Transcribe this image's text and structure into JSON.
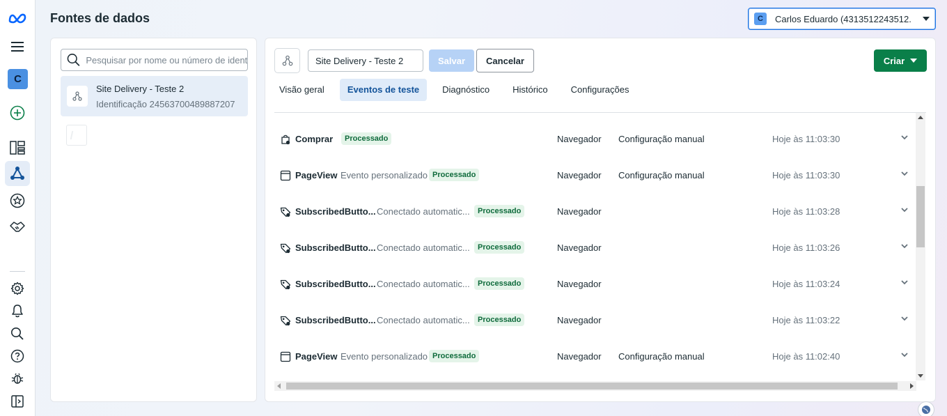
{
  "page": {
    "title": "Fontes de dados"
  },
  "account": {
    "badge": "C",
    "label": "Carlos Eduardo (4313512243512..."
  },
  "rail": {
    "avatar_letter": "C"
  },
  "search": {
    "placeholder": "Pesquisar por nome ou número de identificação"
  },
  "sources": [
    {
      "name": "Site Delivery - Teste 2",
      "id_text": "Identificação 24563700489887207"
    }
  ],
  "editor": {
    "name_value": "Site Delivery - Teste 2",
    "save_label": "Salvar",
    "cancel_label": "Cancelar",
    "create_label": "Criar"
  },
  "tabs": [
    {
      "label": "Visão geral"
    },
    {
      "label": "Eventos de teste"
    },
    {
      "label": "Diagnóstico"
    },
    {
      "label": "Histórico"
    },
    {
      "label": "Configurações"
    }
  ],
  "active_tab": "Eventos de teste",
  "events": [
    {
      "icon": "shopping-bag-icon",
      "name": "Comprar",
      "subtitle": "",
      "status": "Processado",
      "source": "Navegador",
      "config": "Configuração manual",
      "time": "Hoje às 11:03:30"
    },
    {
      "icon": "browser-window-icon",
      "name": "PageView",
      "subtitle": "Evento personalizado",
      "status": "Processado",
      "source": "Navegador",
      "config": "Configuração manual",
      "time": "Hoje às 11:03:30"
    },
    {
      "icon": "tag-icon",
      "name": "SubscribedButto...",
      "subtitle": "Conectado automatic...",
      "status": "Processado",
      "source": "Navegador",
      "config": "",
      "time": "Hoje às 11:03:28"
    },
    {
      "icon": "tag-icon",
      "name": "SubscribedButto...",
      "subtitle": "Conectado automatic...",
      "status": "Processado",
      "source": "Navegador",
      "config": "",
      "time": "Hoje às 11:03:26"
    },
    {
      "icon": "tag-icon",
      "name": "SubscribedButto...",
      "subtitle": "Conectado automatic...",
      "status": "Processado",
      "source": "Navegador",
      "config": "",
      "time": "Hoje às 11:03:24"
    },
    {
      "icon": "tag-icon",
      "name": "SubscribedButto...",
      "subtitle": "Conectado automatic...",
      "status": "Processado",
      "source": "Navegador",
      "config": "",
      "time": "Hoje às 11:03:22"
    },
    {
      "icon": "browser-window-icon",
      "name": "PageView",
      "subtitle": "Evento personalizado",
      "status": "Processado",
      "source": "Navegador",
      "config": "Configuração manual",
      "time": "Hoje às 11:02:40"
    }
  ],
  "colors": {
    "accent": "#0a7f49",
    "brand_blue": "#1b74e4",
    "tab_active_bg": "#dfebf9",
    "status_bg": "#e4f4e9",
    "status_text": "#0f6b3c"
  }
}
